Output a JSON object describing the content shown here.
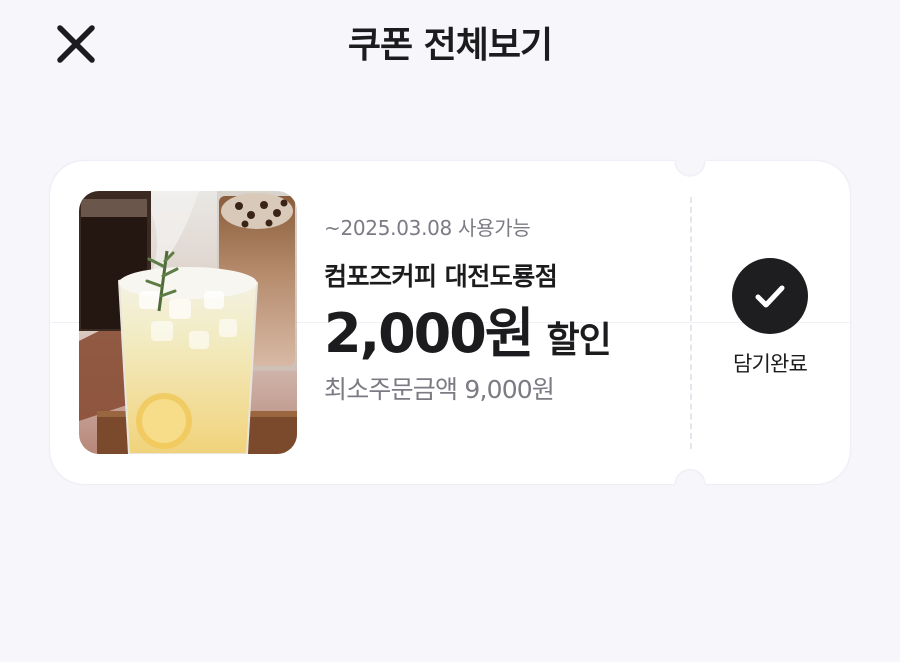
{
  "header": {
    "title": "쿠폰 전체보기",
    "close_icon": "close-icon"
  },
  "coupon": {
    "valid_until": "~2025.03.08 사용가능",
    "store_name": "컴포즈커피 대전도룡점",
    "discount_amount": "2,000원",
    "discount_suffix": "할인",
    "min_order": "최소주문금액 9,000원",
    "status_icon": "check-icon",
    "status_label": "담기완료"
  },
  "colors": {
    "background": "#f6f6fb",
    "card": "#ffffff",
    "primary_text": "#1c1c1e",
    "secondary_text": "#7b7b83",
    "check_circle": "#1e1e20"
  }
}
